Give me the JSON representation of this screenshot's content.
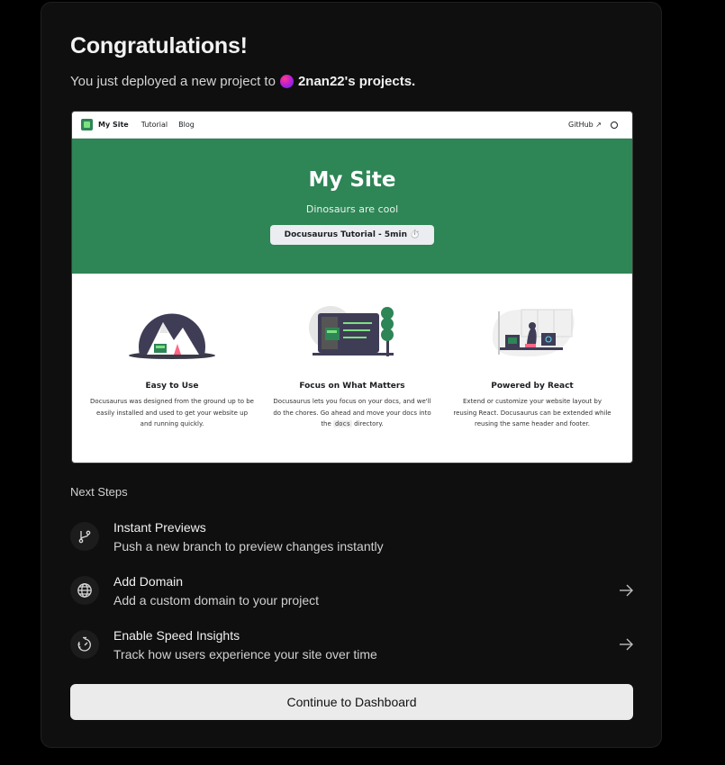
{
  "heading": "Congratulations!",
  "subtitle": {
    "prefix": "You just deployed a new project to",
    "team": "2nan22's projects."
  },
  "preview": {
    "nav": {
      "brand": "My Site",
      "links": [
        "Tutorial",
        "Blog"
      ],
      "github": "GitHub"
    },
    "hero": {
      "title": "My Site",
      "tagline": "Dinosaurs are cool",
      "button": "Docusaurus Tutorial - 5min ⏱️"
    },
    "features": [
      {
        "title": "Easy to Use",
        "text": "Docusaurus was designed from the ground up to be easily installed and used to get your website up and running quickly."
      },
      {
        "title": "Focus on What Matters",
        "text_before": "Docusaurus lets you focus on your docs, and we'll do the chores. Go ahead and move your docs into the",
        "code": "docs",
        "text_after": "directory."
      },
      {
        "title": "Powered by React",
        "text": "Extend or customize your website layout by reusing React. Docusaurus can be extended while reusing the same header and footer."
      }
    ]
  },
  "next_steps": {
    "label": "Next Steps",
    "items": [
      {
        "title": "Instant Previews",
        "description": "Push a new branch to preview changes instantly",
        "icon": "git-branch-icon",
        "has_arrow": false
      },
      {
        "title": "Add Domain",
        "description": "Add a custom domain to your project",
        "icon": "globe-icon",
        "has_arrow": true
      },
      {
        "title": "Enable Speed Insights",
        "description": "Track how users experience your site over time",
        "icon": "speed-gauge-icon",
        "has_arrow": true
      }
    ]
  },
  "continue_button": "Continue to Dashboard",
  "colors": {
    "preview_green": "#2e8555",
    "background": "#000000",
    "card": "#0f0f0f",
    "button": "#ebebeb"
  }
}
